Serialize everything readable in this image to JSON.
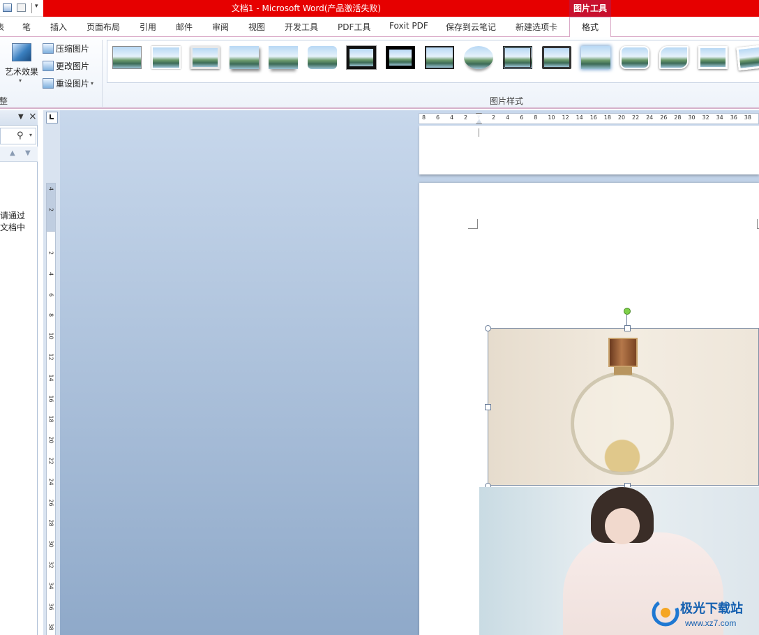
{
  "title_bar": {
    "title": "文档1 - Microsoft Word(产品激活失败)",
    "context_tab_group": "图片工具"
  },
  "tabs": [
    "表",
    "笔",
    "插入",
    "页面布局",
    "引用",
    "邮件",
    "审阅",
    "视图",
    "开发工具",
    "PDF工具",
    "Foxit PDF",
    "保存到云笔记",
    "新建选项卡",
    "格式"
  ],
  "active_tab": "格式",
  "ribbon": {
    "adjust_group": {
      "label": "整",
      "art_effect": "艺术效果",
      "compress": "压缩图片",
      "change": "更改图片",
      "reset": "重设图片"
    },
    "styles_group": {
      "label": "图片样式"
    }
  },
  "nav_pane": {
    "line1": "请通过",
    "line2": "文档中"
  },
  "horizontal_ruler": [
    "8",
    "6",
    "4",
    "2",
    "2",
    "4",
    "6",
    "8",
    "10",
    "12",
    "14",
    "16",
    "18",
    "20",
    "22",
    "24",
    "26",
    "28",
    "30",
    "32",
    "34",
    "36",
    "38"
  ],
  "vertical_ruler": [
    "4",
    "2",
    "2",
    "4",
    "6",
    "8",
    "10",
    "12",
    "14",
    "16",
    "18",
    "20",
    "22",
    "24",
    "26",
    "28",
    "30",
    "32",
    "34",
    "36",
    "38"
  ],
  "watermark": {
    "text": "极光下载站",
    "url": "www.xz7.com"
  },
  "colors": {
    "title_red": "#e60000",
    "context_red": "#c8102e",
    "rotate_handle": "#7fd04a"
  }
}
